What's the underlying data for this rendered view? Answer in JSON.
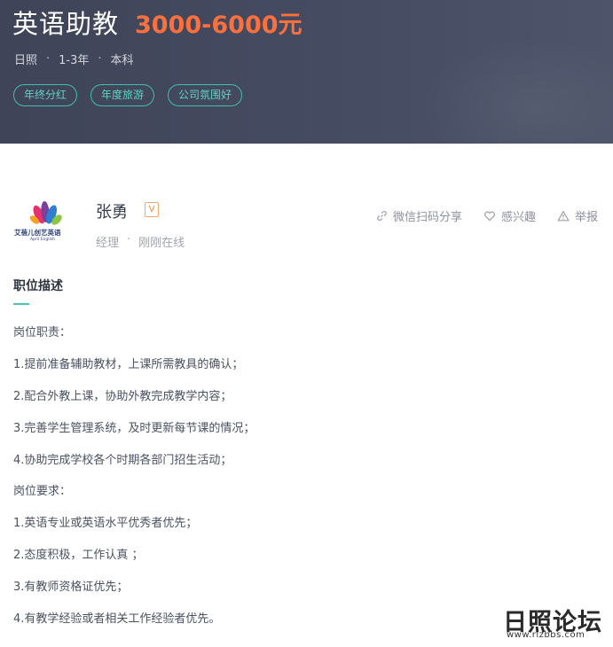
{
  "job": {
    "title": "英语助教",
    "salary": "3000-6000元",
    "location": "日照",
    "experience": "1-3年",
    "education": "本科",
    "meta_sep": "·",
    "tags": [
      "年终分红",
      "年度旅游",
      "公司氛围好"
    ]
  },
  "company": {
    "logo_text": "艾蓓儿创艺英语",
    "logo_sub": "April English"
  },
  "recruiter": {
    "name": "张勇",
    "badge": "V",
    "position": "经理",
    "status": "刚刚在线",
    "sep": "·"
  },
  "actions": {
    "share": "微信扫码分享",
    "interest": "感兴趣",
    "report": "举报"
  },
  "section": {
    "title": "职位描述",
    "lines": [
      "岗位职责：",
      "1.提前准备辅助教材，上课所需教具的确认；",
      "2.配合外教上课，协助外教完成教学内容；",
      "3.完善学生管理系统，及时更新每节课的情况；",
      "4.协助完成学校各个时期各部门招生活动；",
      "岗位要求：",
      "1.英语专业或英语水平优秀者优先；",
      "2.态度积极，工作认真 ；",
      "3.有教师资格证优先；",
      "4.有教学经验或者相关工作经验者优先。"
    ]
  },
  "watermark": {
    "main": "日照论坛",
    "url": "www.rizbbs.com"
  },
  "colors": {
    "header_bg": "#464c62",
    "salary": "#fc703e",
    "tag_border": "#3fbfb2",
    "accent": "#45c3b5"
  }
}
